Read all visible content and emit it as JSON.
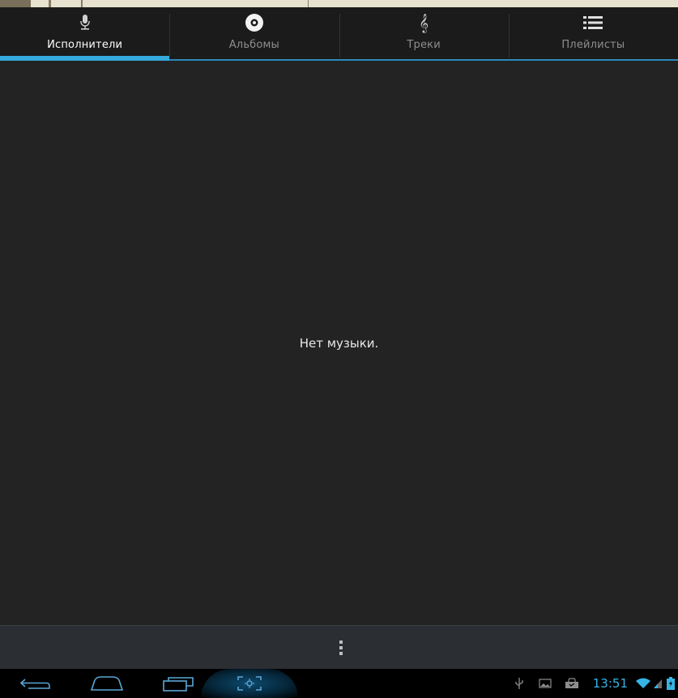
{
  "tabs": [
    {
      "label": "Исполнители",
      "icon": "microphone-icon",
      "active": true
    },
    {
      "label": "Альбомы",
      "icon": "album-disc-icon",
      "active": false
    },
    {
      "label": "Треки",
      "icon": "treble-clef-icon",
      "active": false
    },
    {
      "label": "Плейлисты",
      "icon": "playlist-icon",
      "active": false
    }
  ],
  "content": {
    "empty_message": "Нет музыки."
  },
  "actionbar": {
    "overflow_icon": "overflow-menu-icon"
  },
  "navbar": {
    "back_icon": "back-icon",
    "home_icon": "home-icon",
    "recents_icon": "recent-apps-icon",
    "screenshot_icon": "screenshot-icon"
  },
  "status": {
    "time": "13:51",
    "icons": [
      "usb-icon",
      "image-notification-icon",
      "shopping-bag-icon",
      "wifi-icon",
      "signal-icon",
      "battery-icon"
    ]
  },
  "colors": {
    "accent": "#34aadc",
    "clock": "#35b5e5",
    "background": "#232323"
  }
}
